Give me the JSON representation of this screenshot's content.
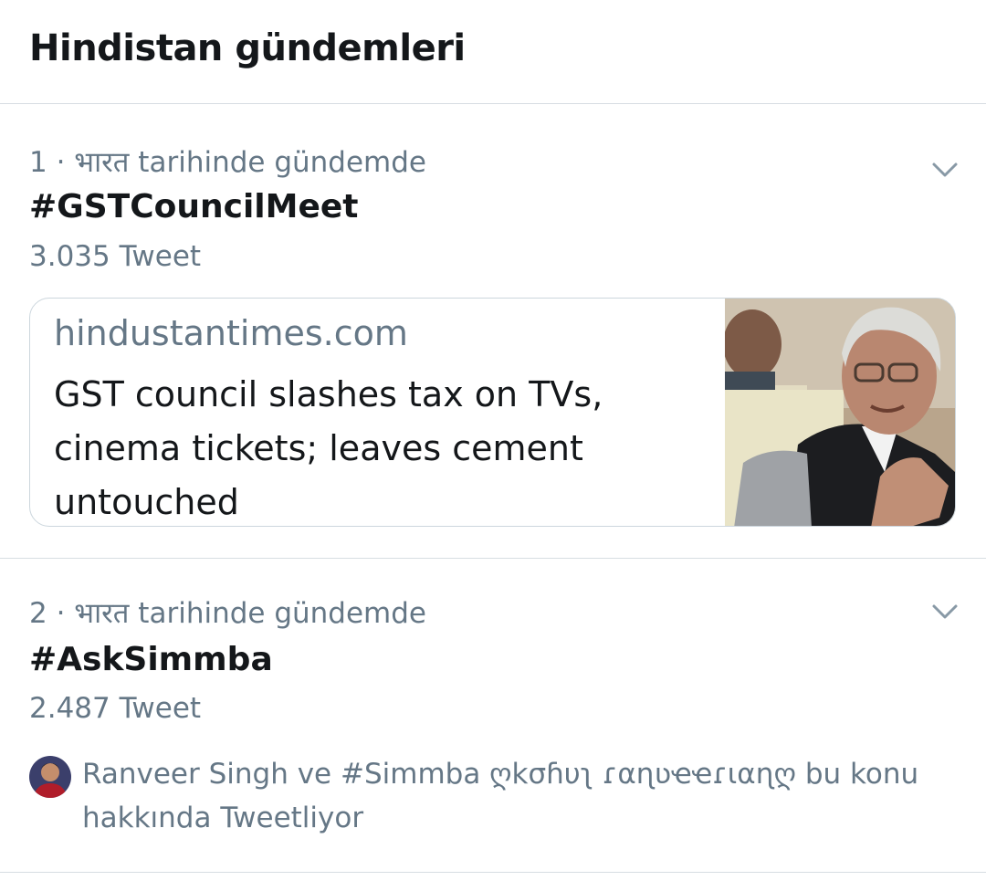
{
  "header": {
    "title": "Hindistan gündemleri"
  },
  "trends": [
    {
      "meta": "1 · भारत tarihinde gündemde",
      "hashtag": "#GSTCouncilMeet",
      "count": "3.035 Tweet",
      "card": {
        "domain": "hindustantimes.com",
        "headline": "GST council slashes tax on TVs, cinema tickets; leaves cement untouched"
      }
    },
    {
      "meta": "2 · भारत tarihinde gündemde",
      "hashtag": "#AskSimmba",
      "count": "2.487 Tweet",
      "context": "Ranveer Singh ve #Simmba ღkσɦυʅ ɾαɳʋҽҽɾιαɳღ bu konu hakkında Tweetliyor"
    }
  ],
  "icons": {
    "more": "chevron-down-icon"
  },
  "colors": {
    "text_primary": "#14171a",
    "text_secondary": "#657786",
    "divider": "#d7dde2",
    "card_border": "#ccd6dd"
  }
}
